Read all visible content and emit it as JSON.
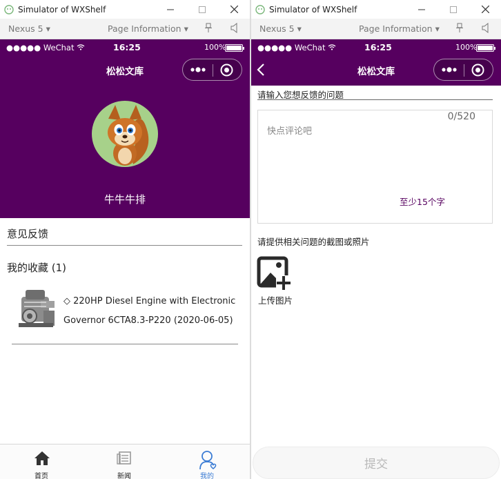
{
  "left": {
    "window": {
      "title": "Simulator of WXShelf"
    },
    "toolbar": {
      "device": "Nexus 5",
      "page_info": "Page Information"
    },
    "status": {
      "signal": "●●●●● WeChat",
      "time": "16:25",
      "battery": "100%"
    },
    "nav": {
      "title": "松松文库"
    },
    "profile": {
      "username": "牛牛牛排"
    },
    "menu": {
      "feedback": "意见反馈",
      "favorites": "我的收藏 (1)"
    },
    "favorite_item": {
      "line1": "◇ 220HP Diesel Engine with Electronic",
      "line2": "Governor 6CTA8.3-P220 (2020-06-05)"
    },
    "tabbar": {
      "home": "首页",
      "news": "新闻",
      "mine": "我的"
    }
  },
  "right": {
    "window": {
      "title": "Simulator of WXShelf"
    },
    "toolbar": {
      "device": "Nexus 5",
      "page_info": "Page Information"
    },
    "status": {
      "signal": "●●●●● WeChat",
      "time": "16:25",
      "battery": "100%"
    },
    "nav": {
      "title": "松松文库"
    },
    "form": {
      "question_label": "请输入您想反馈的问题",
      "counter": "0/520",
      "placeholder": "快点评论吧",
      "min_hint": "至少15个字",
      "screenshot_label": "请提供相关问题的截图或照片",
      "upload_label": "上传图片",
      "submit_label": "提交"
    }
  },
  "colors": {
    "brand": "#56005f",
    "active_tab": "#3b7cd4"
  },
  "icons": [
    "wxshelf-app-icon",
    "minimize-icon",
    "maximize-icon",
    "close-icon",
    "pin-icon",
    "speaker-icon",
    "wifi-icon",
    "back-icon",
    "more-dots-icon",
    "target-icon",
    "home-icon",
    "news-icon",
    "user-icon",
    "add-image-icon"
  ]
}
